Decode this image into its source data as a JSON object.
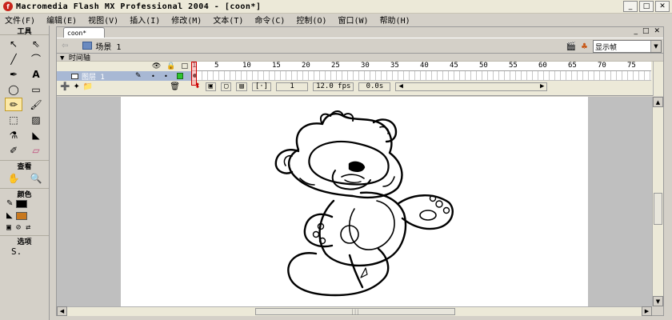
{
  "window": {
    "title": "Macromedia Flash MX Professional 2004 - [coon*]",
    "app_icon": "f",
    "controls": [
      "_",
      "□",
      "✕"
    ]
  },
  "menu": [
    "文件(F)",
    "编辑(E)",
    "视图(V)",
    "插入(I)",
    "修改(M)",
    "文本(T)",
    "命令(C)",
    "控制(O)",
    "窗口(W)",
    "帮助(H)"
  ],
  "toolbox": {
    "title": "工具",
    "view_label": "查看",
    "colors_label": "颜色",
    "options_label": "选项",
    "stroke_color": "#000000",
    "fill_color": "#c8781e",
    "option_glyph": "S."
  },
  "document": {
    "tab": "coon*",
    "controls": [
      "_",
      "□",
      "✕"
    ],
    "scene": "场景 1",
    "zoom": "显示帧"
  },
  "timeline": {
    "label": "▼ 时间轴",
    "layer_name": "图层 1",
    "ruler": [
      "1",
      "5",
      "10",
      "15",
      "20",
      "25",
      "30",
      "35",
      "40",
      "45",
      "50",
      "55",
      "60",
      "65",
      "70",
      "75"
    ],
    "current_frame": "1",
    "fps": "12.0 fps",
    "elapsed": "0.0s"
  }
}
